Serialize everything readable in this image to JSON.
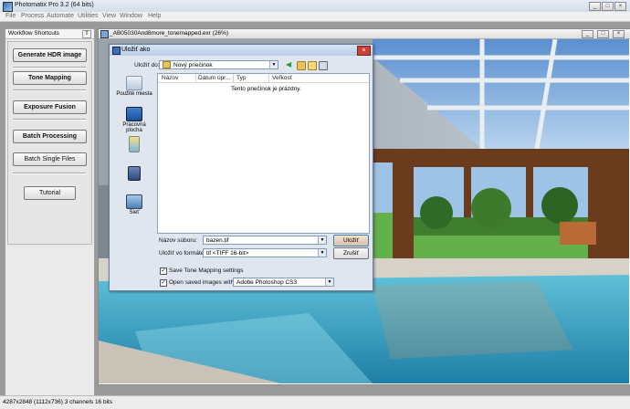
{
  "app": {
    "title": "Photomatix Pro 3.2 (64 bits)",
    "window_buttons": [
      "_",
      "□",
      "×"
    ]
  },
  "menu": [
    "File",
    "Process",
    "Automate",
    "Utilities",
    "View",
    "Window",
    "Help"
  ],
  "workflow": {
    "title": "Workflow Shortcuts",
    "pin": "⇧",
    "buttons": {
      "generate_hdr": "Generate HDR image",
      "tone_mapping": "Tone Mapping",
      "exposure_fusion": "Exposure Fusion",
      "batch_processing": "Batch Processing",
      "batch_single": "Batch Single Files",
      "tutorial": "Tutorial"
    }
  },
  "image_window": {
    "title": "_AB05030And8more_tonemapped.exr (26%)",
    "buttons": [
      "_",
      "□",
      "×"
    ]
  },
  "dialog": {
    "title": "Uložiť ako",
    "save_in_label": "Uložiť do:",
    "save_in_value": "Nový priečinok",
    "places": [
      "Použité miesta",
      "Pracovná plocha",
      "",
      "",
      "Sieť"
    ],
    "columns": [
      "Názov",
      "Dátum úpr...",
      "Typ",
      "Veľkosť"
    ],
    "empty_message": "Tento priečinok je prázdny.",
    "filename_label": "Názov súboru:",
    "filename_value": "bazen.tif",
    "format_label": "Uložiť vo formáte:",
    "format_value": "tif <TIFF 16-bit>",
    "save_button": "Uložiť",
    "cancel_button": "Zrušiť",
    "save_tm_settings": "Save Tone Mapping settings",
    "open_saved_with": "Open saved images with:",
    "open_with_value": "Adobe Photoshop CS3",
    "save_tm_checked": true,
    "open_saved_checked": true
  },
  "status": "4287x2848 (1112x736) 3 channels 16 bits",
  "colors": {
    "dialog_bg": "#dfe6ef",
    "title_blue": "#b9cde6",
    "pool_water": "#3aa3c4"
  }
}
